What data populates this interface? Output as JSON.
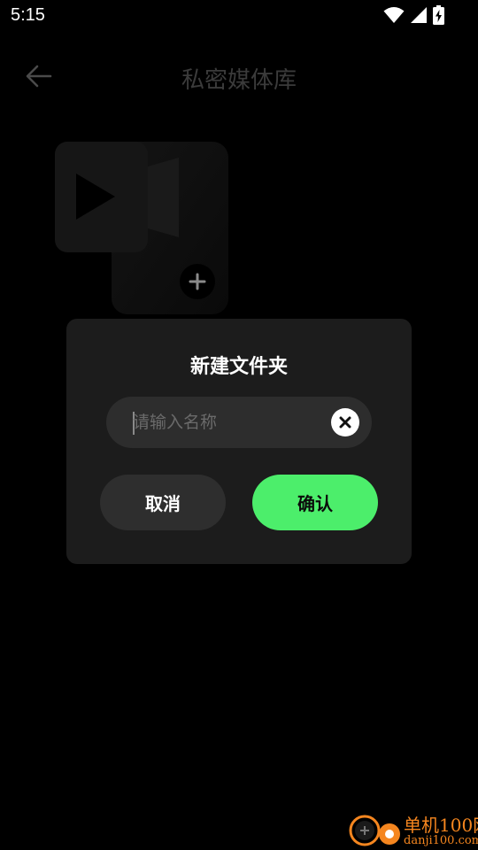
{
  "status_bar": {
    "time": "5:15",
    "icons": [
      "wifi-icon",
      "signal-icon",
      "battery-charging-icon"
    ]
  },
  "header": {
    "back_icon": "arrow-left-icon",
    "title": "私密媒体库"
  },
  "media_tile": {
    "icon": "video-camera-icon",
    "add_icon": "plus-icon"
  },
  "dialog": {
    "title": "新建文件夹",
    "input": {
      "value": "",
      "placeholder": "请输入名称"
    },
    "clear_icon": "close-icon",
    "cancel_label": "取消",
    "confirm_label": "确认"
  },
  "watermark": {
    "name": "单机100网",
    "url": "danji100.com"
  },
  "colors": {
    "background": "#000000",
    "dialog_bg": "#1c1c1c",
    "input_bg": "#2d2d2d",
    "cancel_bg": "#2e2e2e",
    "accent": "#4cee6b",
    "title_dim": "#3b3b3b",
    "watermark": "#f5861f"
  }
}
